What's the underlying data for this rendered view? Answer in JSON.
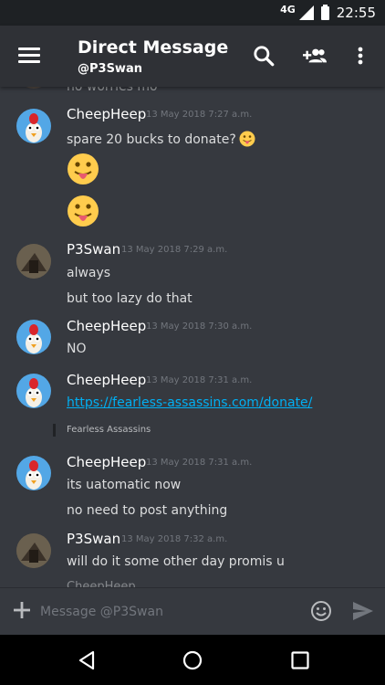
{
  "status_bar": {
    "network": "4G",
    "time": "22:55"
  },
  "header": {
    "title": "Direct Message",
    "subtitle": "@P3Swan"
  },
  "icons": {
    "menu": "hamburger-icon",
    "search": "search-icon",
    "add_user": "add-friend-icon",
    "more": "kebab-icon",
    "attach": "plus-icon",
    "emoji": "emoji-icon",
    "send": "send-icon"
  },
  "colors": {
    "background": "#36393f",
    "header": "#2f3136",
    "link": "#00b0f4",
    "timestamp": "#72767d"
  },
  "peek_top": "no worries mo",
  "messages": [
    {
      "author": "CheepHeep",
      "time": "13 May 2018 7:27 a.m.",
      "lines": [
        "spare 20 bucks to donate?"
      ],
      "emoji_inline": "tongue-emoji",
      "emoji_big": [
        "tongue-emoji",
        "tongue-emoji"
      ]
    },
    {
      "author": "P3Swan",
      "time": "13 May 2018 7:29 a.m.",
      "lines": [
        "always",
        "but too lazy do that"
      ]
    },
    {
      "author": "CheepHeep",
      "time": "13 May 2018 7:30 a.m.",
      "lines": [
        "NO"
      ]
    },
    {
      "author": "CheepHeep",
      "time": "13 May 2018 7:31 a.m.",
      "link": "https://fearless-assassins.com/donate/",
      "embed": "Fearless Assassins"
    },
    {
      "author": "CheepHeep",
      "time": "13 May 2018 7:31 a.m.",
      "lines": [
        "its uatomatic now",
        "no need to post anything"
      ]
    },
    {
      "author": "P3Swan",
      "time": "13 May 2018 7:32 a.m.",
      "lines": [
        "will do it some other day promis u"
      ]
    }
  ],
  "peek_bottom": "CheepHeep",
  "composer": {
    "placeholder": "Message @P3Swan"
  }
}
